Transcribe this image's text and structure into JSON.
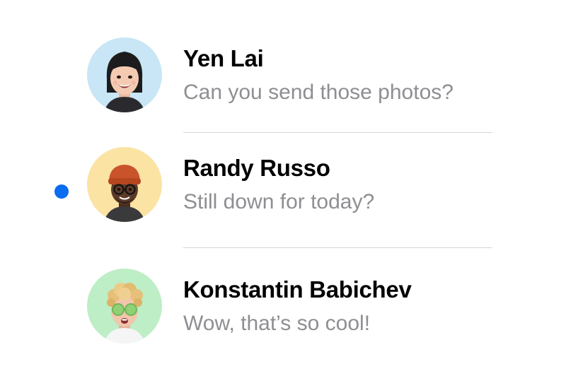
{
  "accent_color": "#0a6cf0",
  "conversations": [
    {
      "name": "Yen Lai",
      "preview": "Can you send those photos?",
      "unread": false,
      "avatar_icon": "memoji-yen-lai",
      "avatar_bg": "#c8e6f5"
    },
    {
      "name": "Randy Russo",
      "preview": "Still down for today?",
      "unread": true,
      "avatar_icon": "memoji-randy-russo",
      "avatar_bg": "#fbe3a4"
    },
    {
      "name": "Konstantin Babichev",
      "preview": "Wow, that’s so cool!",
      "unread": false,
      "avatar_icon": "memoji-konstantin-babichev",
      "avatar_bg": "#bdeec6"
    }
  ]
}
